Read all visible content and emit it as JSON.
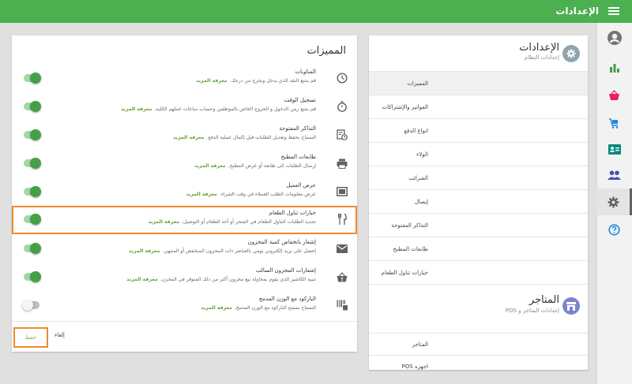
{
  "header": {
    "title": "الإعدادات",
    "menu_icon": "hamburger-icon"
  },
  "rail": [
    {
      "icon": "account-circle-icon"
    },
    {
      "icon": "bar-chart-icon"
    },
    {
      "icon": "basket-icon"
    },
    {
      "icon": "cart-icon"
    },
    {
      "icon": "contact-card-icon"
    },
    {
      "icon": "people-icon"
    },
    {
      "icon": "gear-icon"
    },
    {
      "icon": "help-icon"
    }
  ],
  "settings": {
    "title": "الإعدادات",
    "subtitle": "إعدادات النظام",
    "items": [
      "المميزات",
      "الفواتير والإشتراكات",
      "انواع الدفع",
      "الولاء",
      "الضرائب",
      "إيصال",
      "التذاكر المفتوحة",
      "طابعات المطبخ",
      "خيارات تناول الطعام"
    ]
  },
  "stores": {
    "title": "المتاجر",
    "subtitle": "إعدادات المتاجر و POS",
    "items": [
      "المتاجر",
      "اجهزه POS"
    ]
  },
  "features": {
    "title": "المميزات",
    "more_label": "معرفة المزيد",
    "items": [
      {
        "name": "المناوبات",
        "desc": "قم بتتبع النقد الذي يدخل ويخرج من درجك.",
        "on": true,
        "icon": "clock-icon"
      },
      {
        "name": "تسجيل الوقت",
        "desc": "قم بتتبع زمن الدخول و الخروج الخاص بالموظفين وحساب ساعات عملهم الكلية.",
        "on": true,
        "icon": "stopwatch-icon"
      },
      {
        "name": "التذاكر المفتوحة",
        "desc": "السماح بحفظ وتعديل الطلبات قبل إكمال عملية الدفع.",
        "on": true,
        "icon": "ticket-clock-icon"
      },
      {
        "name": "طابعات المطبخ",
        "desc": "إرسال الطلبات إلى طابعة أو عرض المطبخ.",
        "on": true,
        "icon": "printer-icon"
      },
      {
        "name": "عرض العميل",
        "desc": "عرض معلومات الطلب للعملاء في وقت الشراء.",
        "on": true,
        "icon": "display-icon"
      },
      {
        "name": "خيارات تناول الطعام",
        "desc": "تحديد الطلبات كتناول الطعام في المتجر أو أخذ الطعام أو التوصيل.",
        "on": true,
        "icon": "fork-knife-icon"
      },
      {
        "name": "إشعار بانخفاض كمية المخزون",
        "desc": "إحصل على بريد إلكتروني يومي بالعناصر ذات المخزون المنخفض أو المنتهي.",
        "on": true,
        "icon": "mail-icon"
      },
      {
        "name": "إشعارات المخزون السالب",
        "desc": "تنبيه الكاشير الذي يقوم بمحاولة بيع مخزون أكثر من ذلك المتوفر في المخزن.",
        "on": true,
        "icon": "warning-basket-icon"
      },
      {
        "name": "الباركود مع الوزن المدمج",
        "desc": "السماح بمسح الباركود مع الوزن المدمج.",
        "on": false,
        "icon": "barcode-icon"
      }
    ],
    "save_label": "حفظ",
    "cancel_label": "إلغاء"
  },
  "colors": {
    "brand": "#4caf50",
    "accent": "#ef8a2f",
    "link": "#689f38"
  }
}
